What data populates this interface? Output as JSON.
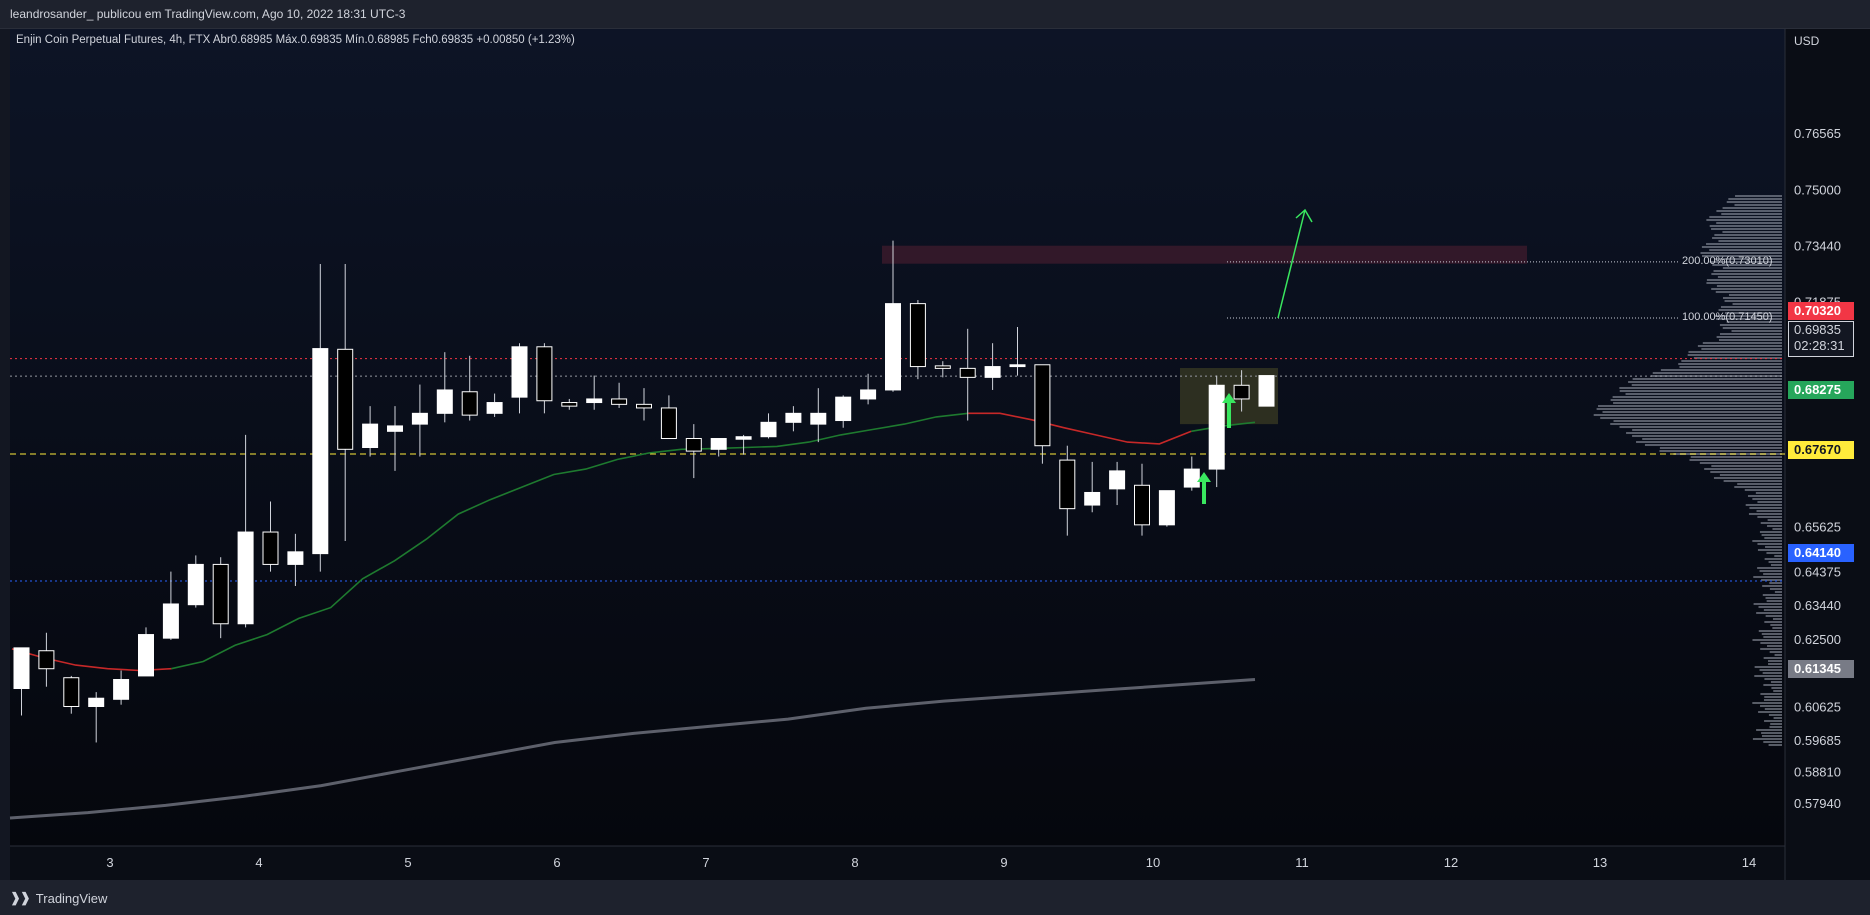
{
  "header": {
    "publish_info": "leandrosander_ publicou em TradingView.com, Ago 10, 2022 18:31 UTC-3"
  },
  "legend": {
    "symbol": "Enjin Coin Perpetual Futures, 4h, FTX",
    "open_label": "Abr",
    "open": "0.68985",
    "high_label": "Máx.",
    "high": "0.69835",
    "low_label": "Mín.",
    "low": "0.68985",
    "close_label": "Fch",
    "close": "0.69835",
    "change": "+0.00850 (+1.23%)"
  },
  "price_axis": {
    "currency": "USD",
    "ticks": [
      "0.76565",
      "0.75000",
      "0.73440",
      "0.71875",
      "0.70625",
      "0.65625",
      "0.64375",
      "0.63440",
      "0.62500",
      "0.61560",
      "0.60625",
      "0.59685",
      "0.58810",
      "0.57940"
    ]
  },
  "price_tags": {
    "red": "0.70320",
    "current": "0.69835",
    "countdown": "02:28:31",
    "green": "0.68275",
    "yellow": "0.67670",
    "blue": "0.64140",
    "gray": "0.61345"
  },
  "fib_labels": {
    "fib_200": "200.00%(0.73010)",
    "fib_100": "100.00%(0.71450)"
  },
  "footer": {
    "brand_logo": "❱❱",
    "brand": "TradingView"
  },
  "colors": {
    "background": "#131722",
    "red_line": "#f23645",
    "green_tag": "#26a65b",
    "yellow_tag": "#ffeb3b",
    "blue_tag": "#2962ff",
    "ema_green": "#1e7a2f",
    "ema_red": "#c62828",
    "ma_gray": "#5d606b",
    "arrow_green": "#39e75f"
  },
  "chart_data": {
    "type": "candlestick",
    "interval": "4h",
    "x_labels": [
      "3",
      "4",
      "5",
      "6",
      "7",
      "8",
      "9",
      "10",
      "11",
      "12",
      "13",
      "14"
    ],
    "ylim": [
      0.5755,
      0.7765
    ],
    "candles": [
      {
        "o": 0.6115,
        "h": 0.6188,
        "l": 0.604,
        "c": 0.6228
      },
      {
        "o": 0.622,
        "h": 0.627,
        "l": 0.612,
        "c": 0.617
      },
      {
        "o": 0.6145,
        "h": 0.615,
        "l": 0.6045,
        "c": 0.6065
      },
      {
        "o": 0.6065,
        "h": 0.6105,
        "l": 0.5965,
        "c": 0.6088
      },
      {
        "o": 0.6085,
        "h": 0.6165,
        "l": 0.607,
        "c": 0.614
      },
      {
        "o": 0.615,
        "h": 0.6285,
        "l": 0.615,
        "c": 0.6265
      },
      {
        "o": 0.6255,
        "h": 0.644,
        "l": 0.625,
        "c": 0.635
      },
      {
        "o": 0.6348,
        "h": 0.6485,
        "l": 0.634,
        "c": 0.646
      },
      {
        "o": 0.646,
        "h": 0.648,
        "l": 0.6255,
        "c": 0.6295
      },
      {
        "o": 0.6295,
        "h": 0.682,
        "l": 0.6285,
        "c": 0.655
      },
      {
        "o": 0.655,
        "h": 0.6635,
        "l": 0.644,
        "c": 0.646
      },
      {
        "o": 0.646,
        "h": 0.6545,
        "l": 0.64,
        "c": 0.6495
      },
      {
        "o": 0.649,
        "h": 0.7295,
        "l": 0.644,
        "c": 0.706
      },
      {
        "o": 0.7058,
        "h": 0.7295,
        "l": 0.6525,
        "c": 0.678
      },
      {
        "o": 0.6785,
        "h": 0.69,
        "l": 0.676,
        "c": 0.685
      },
      {
        "o": 0.683,
        "h": 0.69,
        "l": 0.672,
        "c": 0.6845
      },
      {
        "o": 0.685,
        "h": 0.696,
        "l": 0.676,
        "c": 0.688
      },
      {
        "o": 0.688,
        "h": 0.705,
        "l": 0.6855,
        "c": 0.6945
      },
      {
        "o": 0.694,
        "h": 0.704,
        "l": 0.686,
        "c": 0.6875
      },
      {
        "o": 0.688,
        "h": 0.6935,
        "l": 0.687,
        "c": 0.691
      },
      {
        "o": 0.6925,
        "h": 0.7075,
        "l": 0.688,
        "c": 0.7065
      },
      {
        "o": 0.7065,
        "h": 0.7075,
        "l": 0.688,
        "c": 0.6915
      },
      {
        "o": 0.691,
        "h": 0.692,
        "l": 0.689,
        "c": 0.69
      },
      {
        "o": 0.691,
        "h": 0.6985,
        "l": 0.689,
        "c": 0.692
      },
      {
        "o": 0.692,
        "h": 0.6965,
        "l": 0.6895,
        "c": 0.6905
      },
      {
        "o": 0.6905,
        "h": 0.695,
        "l": 0.686,
        "c": 0.6895
      },
      {
        "o": 0.6895,
        "h": 0.693,
        "l": 0.681,
        "c": 0.681
      },
      {
        "o": 0.681,
        "h": 0.685,
        "l": 0.67,
        "c": 0.6775
      },
      {
        "o": 0.678,
        "h": 0.6805,
        "l": 0.676,
        "c": 0.681
      },
      {
        "o": 0.6808,
        "h": 0.682,
        "l": 0.6765,
        "c": 0.6815
      },
      {
        "o": 0.6815,
        "h": 0.688,
        "l": 0.681,
        "c": 0.6855
      },
      {
        "o": 0.6855,
        "h": 0.69,
        "l": 0.683,
        "c": 0.688
      },
      {
        "o": 0.685,
        "h": 0.695,
        "l": 0.68,
        "c": 0.688
      },
      {
        "o": 0.686,
        "h": 0.693,
        "l": 0.684,
        "c": 0.6925
      },
      {
        "o": 0.692,
        "h": 0.699,
        "l": 0.6905,
        "c": 0.6945
      },
      {
        "o": 0.6945,
        "h": 0.736,
        "l": 0.694,
        "c": 0.7185
      },
      {
        "o": 0.7185,
        "h": 0.7195,
        "l": 0.6975,
        "c": 0.701
      },
      {
        "o": 0.7012,
        "h": 0.7025,
        "l": 0.698,
        "c": 0.7005
      },
      {
        "o": 0.7005,
        "h": 0.7115,
        "l": 0.686,
        "c": 0.698
      },
      {
        "o": 0.698,
        "h": 0.7075,
        "l": 0.6945,
        "c": 0.701
      },
      {
        "o": 0.701,
        "h": 0.712,
        "l": 0.6985,
        "c": 0.7015
      },
      {
        "o": 0.7015,
        "h": 0.7015,
        "l": 0.674,
        "c": 0.679
      },
      {
        "o": 0.675,
        "h": 0.679,
        "l": 0.654,
        "c": 0.6615
      },
      {
        "o": 0.6625,
        "h": 0.6745,
        "l": 0.6605,
        "c": 0.666
      },
      {
        "o": 0.667,
        "h": 0.6745,
        "l": 0.6625,
        "c": 0.672
      },
      {
        "o": 0.668,
        "h": 0.674,
        "l": 0.654,
        "c": 0.657
      },
      {
        "o": 0.657,
        "h": 0.6665,
        "l": 0.6565,
        "c": 0.6665
      },
      {
        "o": 0.6675,
        "h": 0.676,
        "l": 0.6665,
        "c": 0.6725
      },
      {
        "o": 0.6725,
        "h": 0.6985,
        "l": 0.6675,
        "c": 0.6958
      },
      {
        "o": 0.6958,
        "h": 0.7,
        "l": 0.6885,
        "c": 0.692
      },
      {
        "o": 0.69,
        "h": 0.6985,
        "l": 0.69,
        "c": 0.6985
      }
    ],
    "horizontal_levels": [
      {
        "price": 0.7032,
        "style": "dotted",
        "color": "#f23645"
      },
      {
        "price": 0.69835,
        "style": "dotted",
        "color": "#9598a1"
      },
      {
        "price": 0.6767,
        "style": "dashed",
        "color": "#ffeb3b"
      },
      {
        "price": 0.6414,
        "style": "dotted",
        "color": "#2962ff"
      }
    ],
    "fib_levels": [
      0.7301,
      0.7145
    ],
    "resistance_zone": [
      0.7296,
      0.7346
    ],
    "entry_zone": [
      0.685,
      0.7006
    ],
    "ema_short": [
      0.6225,
      0.62,
      0.618,
      0.617,
      0.6165,
      0.617,
      0.619,
      0.6235,
      0.6265,
      0.631,
      0.634,
      0.642,
      0.647,
      0.653,
      0.66,
      0.664,
      0.6675,
      0.671,
      0.6725,
      0.6752,
      0.677,
      0.678,
      0.6782,
      0.6785,
      0.6788,
      0.68,
      0.682,
      0.6835,
      0.685,
      0.687,
      0.688,
      0.688,
      0.6862,
      0.684,
      0.682,
      0.68,
      0.6795,
      0.683,
      0.6845,
      0.6855
    ],
    "ma_long": [
      0.5755,
      0.577,
      0.579,
      0.5815,
      0.5845,
      0.5885,
      0.5925,
      0.5965,
      0.599,
      0.601,
      0.603,
      0.606,
      0.608,
      0.6095,
      0.611,
      0.6125,
      0.614
    ]
  }
}
